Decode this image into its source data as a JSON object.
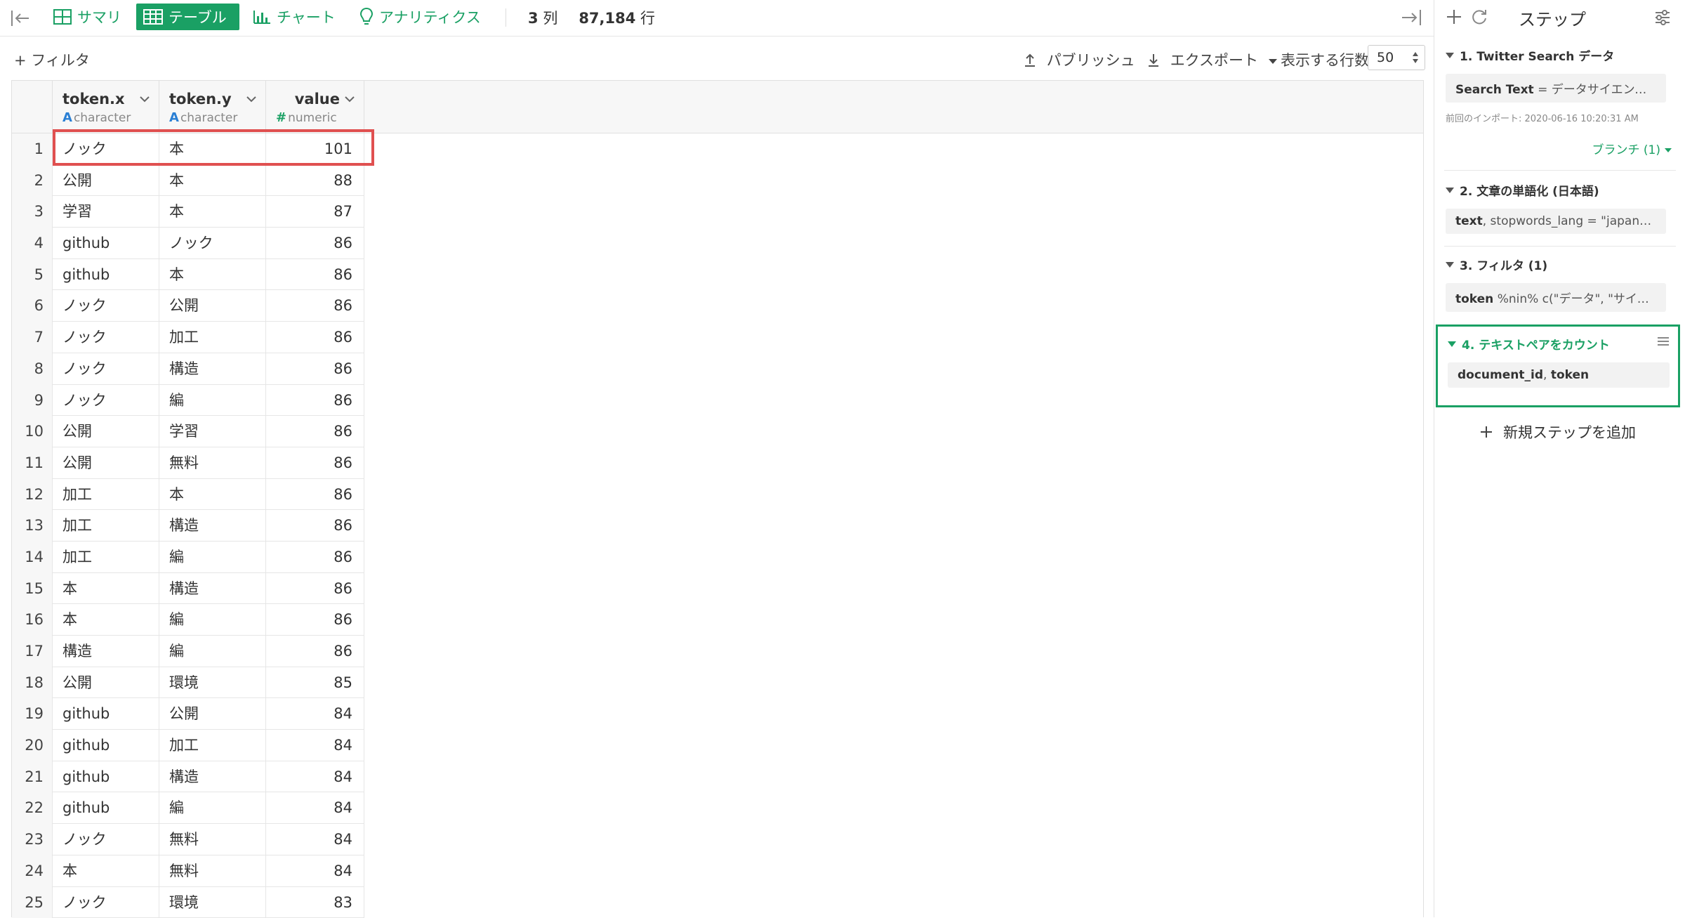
{
  "topbar": {
    "tabs": [
      {
        "label": "サマリ",
        "icon": "grid-icon",
        "active": false
      },
      {
        "label": "テーブル",
        "icon": "table-icon",
        "active": true
      },
      {
        "label": "チャート",
        "icon": "bar-chart-icon",
        "active": false
      },
      {
        "label": "アナリティクス",
        "icon": "lightbulb-icon",
        "active": false
      }
    ],
    "columns_count": "3",
    "columns_unit": "列",
    "rows_count": "87,184",
    "rows_unit": "行"
  },
  "toolbar": {
    "filter_label": "+ フィルタ",
    "publish_label": "パブリッシュ",
    "export_label": "エクスポート",
    "rows_label": "表示する行数",
    "rows_value": "50"
  },
  "table": {
    "columns": [
      {
        "name": "token.x",
        "type_symbol": "A",
        "type": "character"
      },
      {
        "name": "token.y",
        "type_symbol": "A",
        "type": "character"
      },
      {
        "name": "value",
        "type_symbol": "#",
        "type": "numeric"
      }
    ],
    "rows": [
      [
        "1",
        "ノック",
        "本",
        "101"
      ],
      [
        "2",
        "公開",
        "本",
        "88"
      ],
      [
        "3",
        "学習",
        "本",
        "87"
      ],
      [
        "4",
        "github",
        "ノック",
        "86"
      ],
      [
        "5",
        "github",
        "本",
        "86"
      ],
      [
        "6",
        "ノック",
        "公開",
        "86"
      ],
      [
        "7",
        "ノック",
        "加工",
        "86"
      ],
      [
        "8",
        "ノック",
        "構造",
        "86"
      ],
      [
        "9",
        "ノック",
        "編",
        "86"
      ],
      [
        "10",
        "公開",
        "学習",
        "86"
      ],
      [
        "11",
        "公開",
        "無料",
        "86"
      ],
      [
        "12",
        "加工",
        "本",
        "86"
      ],
      [
        "13",
        "加工",
        "構造",
        "86"
      ],
      [
        "14",
        "加工",
        "編",
        "86"
      ],
      [
        "15",
        "本",
        "構造",
        "86"
      ],
      [
        "16",
        "本",
        "編",
        "86"
      ],
      [
        "17",
        "構造",
        "編",
        "86"
      ],
      [
        "18",
        "公開",
        "環境",
        "85"
      ],
      [
        "19",
        "github",
        "公開",
        "84"
      ],
      [
        "20",
        "github",
        "加工",
        "84"
      ],
      [
        "21",
        "github",
        "構造",
        "84"
      ],
      [
        "22",
        "github",
        "編",
        "84"
      ],
      [
        "23",
        "ノック",
        "無料",
        "84"
      ],
      [
        "24",
        "本",
        "無料",
        "84"
      ],
      [
        "25",
        "ノック",
        "環境",
        "83"
      ]
    ]
  },
  "sidebar": {
    "title": "ステップ",
    "steps": [
      {
        "title": "1. Twitter Search データ",
        "key": "Search Text",
        "detail": " = データサイエンス, ...",
        "note": "前回のインポート: 2020-06-16 10:20:31 AM",
        "branch": "ブランチ (1)"
      },
      {
        "title": "2. 文章の単語化 (日本語)",
        "key": "text",
        "detail": ", stopwords_lang = \"japanese\""
      },
      {
        "title": "3. フィルタ (1)",
        "key": "token",
        "detail": " %nin% c(\"データ\", \"サイエ..."
      },
      {
        "title": "4. テキストペアをカウント",
        "key": "document_id",
        "detail": ", ",
        "key2": "token"
      }
    ],
    "add_step_label": "新規ステップを追加"
  },
  "colors": {
    "accent": "#1aa064",
    "highlight": "#e05050",
    "type_char": "#2a7fd4"
  }
}
